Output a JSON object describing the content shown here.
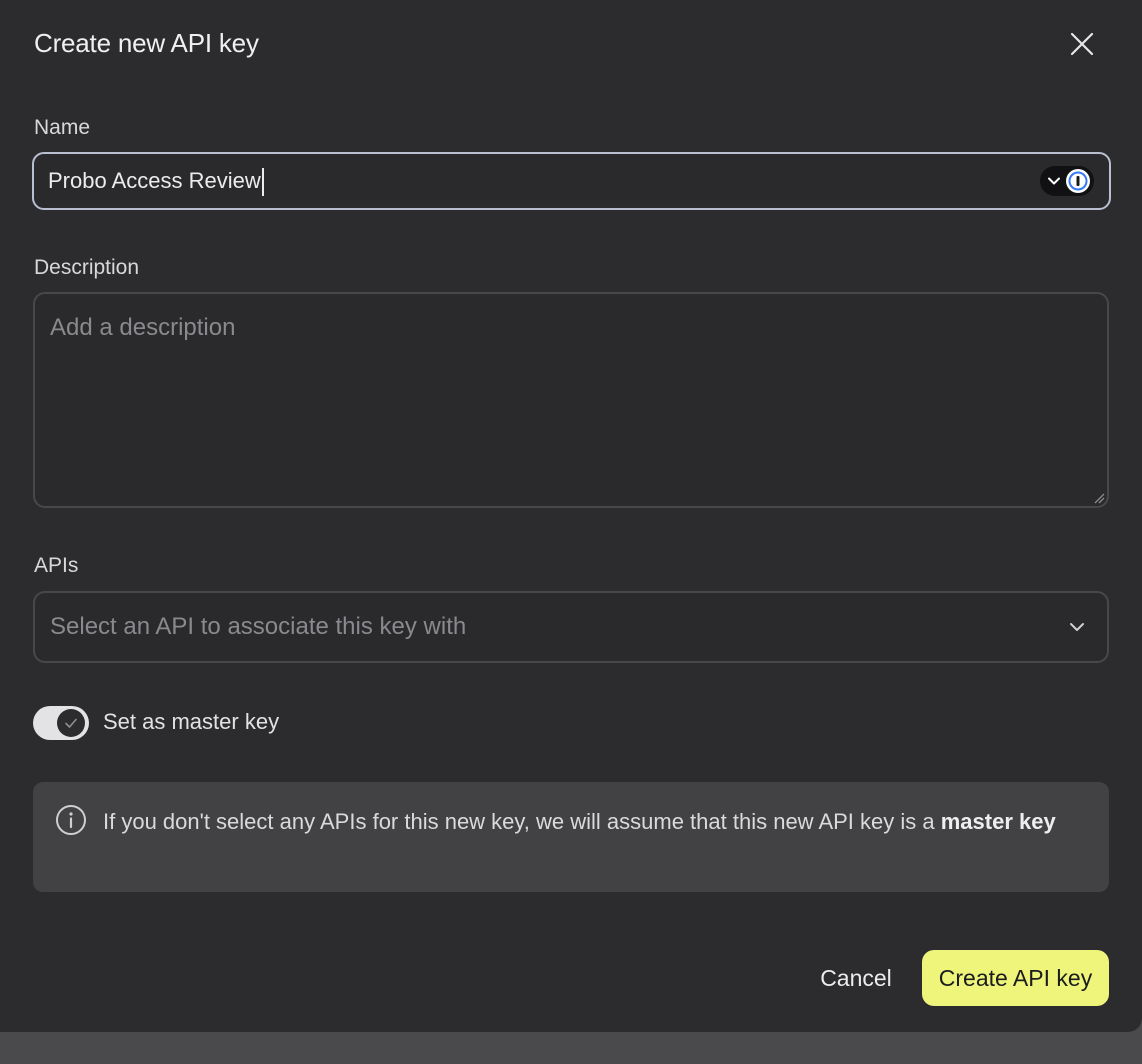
{
  "dialog": {
    "title": "Create new API key",
    "close_icon": "close-icon"
  },
  "form": {
    "name": {
      "label": "Name",
      "value": "Probo Access Review",
      "password_manager_icon": "password-manager-icon"
    },
    "description": {
      "label": "Description",
      "placeholder": "Add a description",
      "value": ""
    },
    "apis": {
      "label": "APIs",
      "placeholder": "Select an API to associate this key with",
      "chevron_icon": "chevron-down-icon"
    },
    "master_key": {
      "label": "Set as master key",
      "checked": true
    }
  },
  "info": {
    "icon": "info-icon",
    "text": "If you don't select any APIs for this new key, we will assume that this new API key is a ",
    "bold_text": "master key"
  },
  "actions": {
    "cancel_label": "Cancel",
    "create_label": "Create API key"
  },
  "colors": {
    "dialog_bg": "#2c2c2e",
    "primary_button": "#eef57a",
    "focus_border": "#b9bfd0"
  }
}
